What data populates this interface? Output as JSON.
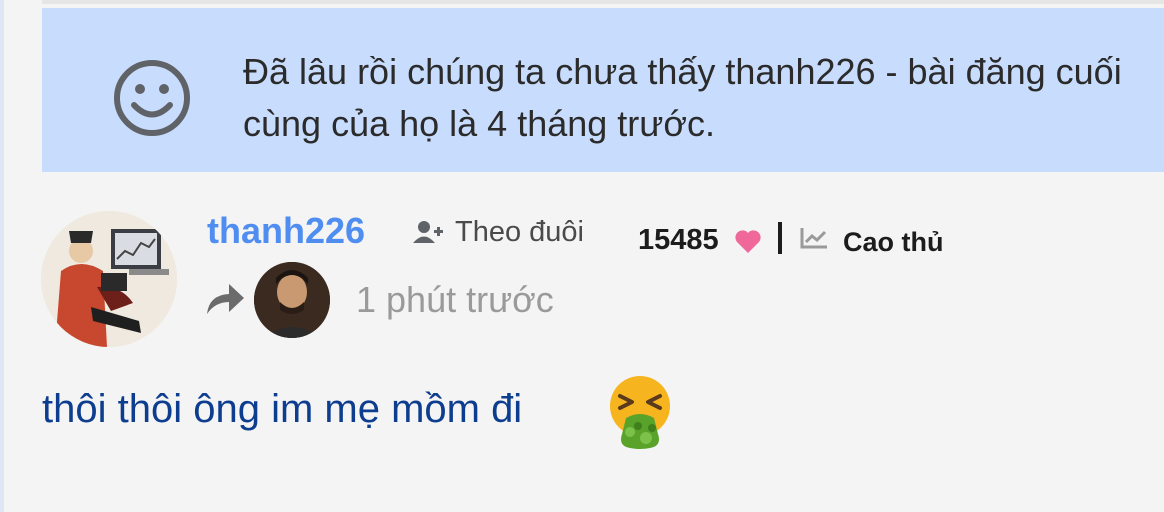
{
  "notice": {
    "icon": "smiley-icon",
    "text": "Đã lâu rồi chúng ta chưa thấy thanh226 - bài đăng cuối cùng của họ là 4 tháng trước."
  },
  "post": {
    "author": "thanh226",
    "follow_label": "Theo đuôi",
    "points": "15485",
    "rank": "Cao thủ",
    "timestamp": "1 phút trước",
    "message": "thôi thôi ông im mẹ mồm đi",
    "icons": [
      "add-user-icon",
      "heart-icon",
      "trend-chart-icon",
      "reply-arrow-icon",
      "vomiting-face-emoji-icon"
    ]
  },
  "colors": {
    "notice_bg": "#c8dcfd",
    "username": "#4f8df0",
    "message": "#0d3d8e",
    "heart": "#f0679a",
    "timestamp": "#9a9a9a"
  }
}
